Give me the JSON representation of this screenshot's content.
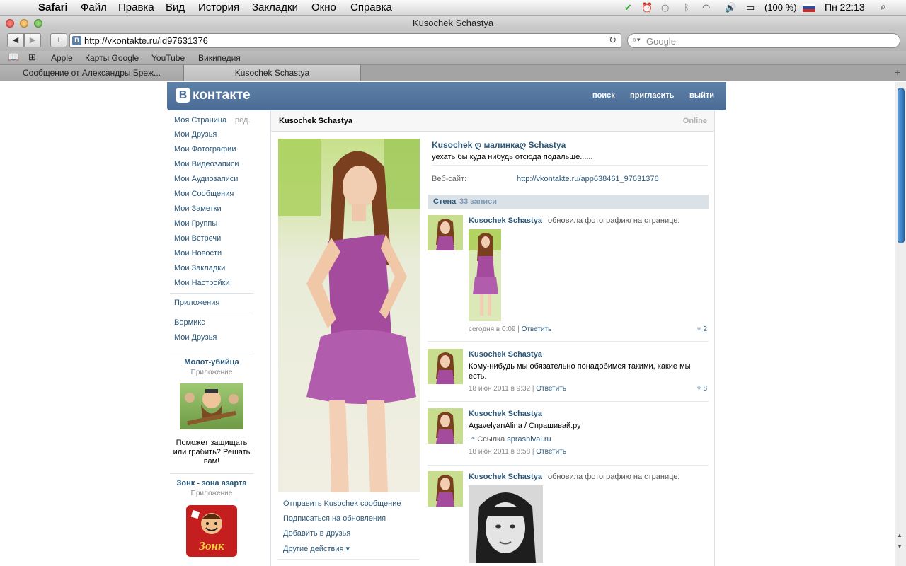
{
  "menubar": {
    "app": "Safari",
    "items": [
      "Файл",
      "Правка",
      "Вид",
      "История",
      "Закладки",
      "Окно",
      "Справка"
    ],
    "battery": "(100 %)",
    "clock": "Пн 22:13"
  },
  "window": {
    "title": "Kusochek Schastya"
  },
  "toolbar": {
    "url": "http://vkontakte.ru/id97631376",
    "favicon": "В",
    "search_placeholder": "Google"
  },
  "bookmarks": [
    "Apple",
    "Карты Google",
    "YouTube",
    "Википедия"
  ],
  "tabs": [
    {
      "label": "Сообщение от Александры Бреж..."
    },
    {
      "label": "Kusochek Schastya"
    }
  ],
  "vk": {
    "logo": "контакте",
    "logo_letter": "В",
    "nav": {
      "search": "поиск",
      "invite": "пригласить",
      "logout": "выйти"
    },
    "left_menu": [
      "Моя Страница",
      "Мои Друзья",
      "Мои Фотографии",
      "Мои Видеозаписи",
      "Мои Аудиозаписи",
      "Мои Сообщения",
      "Мои Заметки",
      "Мои Группы",
      "Мои Встречи",
      "Мои Новости",
      "Мои Закладки",
      "Мои Настройки"
    ],
    "edit": "ред.",
    "apps": "Приложения",
    "apps_list": [
      "Вормикс",
      "Мои Друзья"
    ],
    "ads": [
      {
        "title": "Молот-убийца",
        "sub": "Приложение",
        "text": "Поможет защищать или грабить? Решать вам!"
      },
      {
        "title": "Зонк - зона азарта",
        "sub": "Приложение",
        "logo_text": "Зонк"
      }
    ]
  },
  "profile": {
    "name": "Kusochek Schastya",
    "online": "Online",
    "full_name": "Kusochek ღ малинкаღ Schastya",
    "status": "уехать бы куда нибудь отсюда подальше......",
    "website_label": "Веб-сайт:",
    "website": "http://vkontakte.ru/app638461_97631376",
    "actions": [
      "Отправить Kusochek сообщение",
      "Подписаться на обновления",
      "Добавить в друзья",
      "Другие действия ▾"
    ]
  },
  "wall": {
    "title": "Стена",
    "count": "33 записи",
    "posts": [
      {
        "author": "Kusochek Schastya",
        "action": "обновила фотографию на странице:",
        "date": "сегодня в 0:09",
        "reply": "Ответить",
        "likes": "2"
      },
      {
        "author": "Kusochek Schastya",
        "text": "Кому-нибудь мы обязательно понадобимся такими, какие мы есть.",
        "date": "18 июн 2011 в 9:32",
        "reply": "Ответить",
        "likes": "8"
      },
      {
        "author": "Kusochek Schastya",
        "text": "AgavelyanAlina / Спрашивай.ру",
        "link_label": "Ссылка",
        "link": "sprashivai.ru",
        "date": "18 июн 2011 в 8:58",
        "reply": "Ответить"
      },
      {
        "author": "Kusochek Schastya",
        "action": "обновила фотографию на странице:"
      }
    ]
  },
  "colors": {
    "vk_blue": "#4a6b95",
    "link": "#2b587a"
  }
}
